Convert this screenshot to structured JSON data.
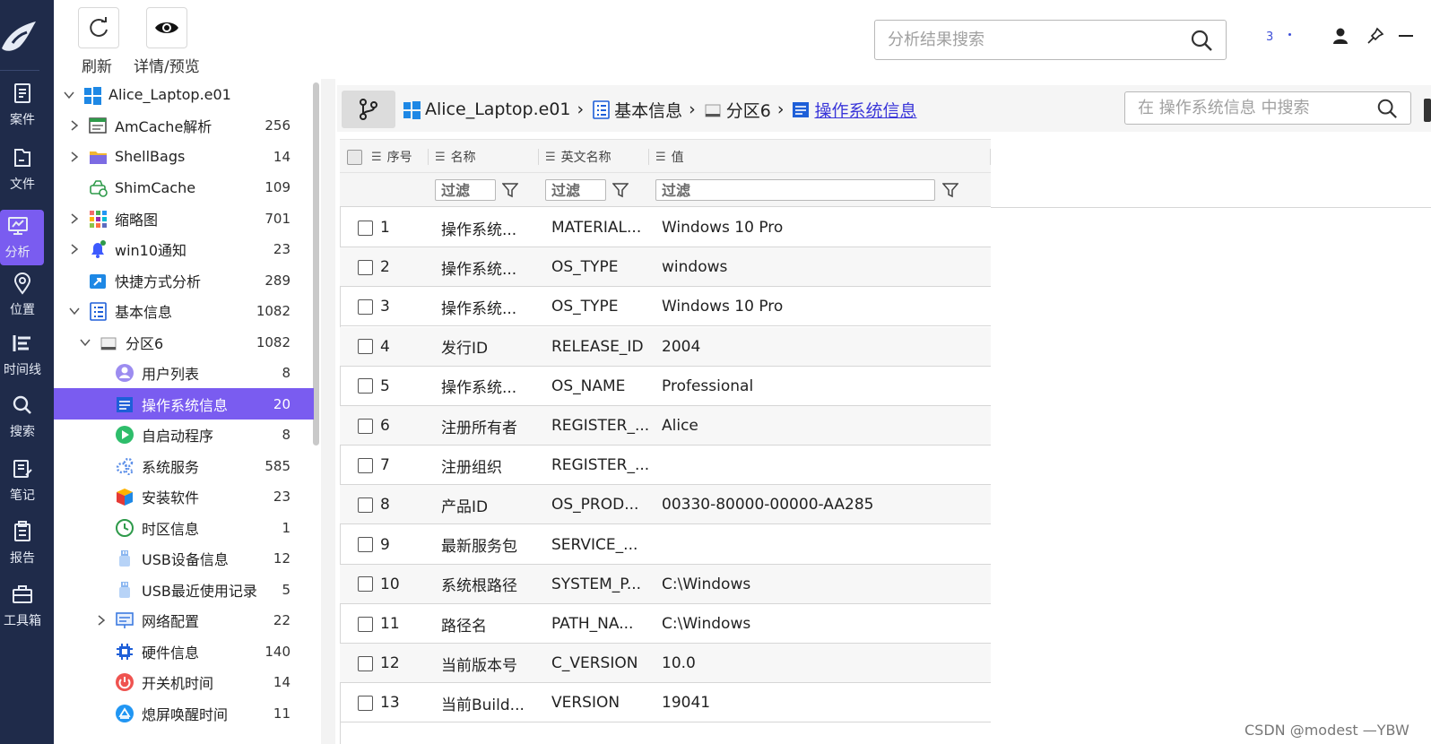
{
  "nav": [
    {
      "label": "案件",
      "icon": "case-icon"
    },
    {
      "label": "文件",
      "icon": "file-icon"
    },
    {
      "label": "分析",
      "icon": "analysis-icon",
      "active": true
    },
    {
      "label": "位置",
      "icon": "location-icon"
    },
    {
      "label": "时间线",
      "icon": "timeline-icon"
    },
    {
      "label": "搜索",
      "icon": "search-icon"
    },
    {
      "label": "笔记",
      "icon": "note-icon"
    },
    {
      "label": "报告",
      "icon": "report-icon"
    },
    {
      "label": "工具箱",
      "icon": "toolbox-icon"
    }
  ],
  "toolbar": {
    "refresh_label": "刷新",
    "preview_label": "详情/预览"
  },
  "top_search": {
    "placeholder": "分析结果搜索"
  },
  "top_count": "3",
  "tree": [
    {
      "label": "Alice_Laptop.e01",
      "count": "",
      "icon": "windows-icon",
      "depth": 0,
      "expand": "open"
    },
    {
      "label": "AmCache解析",
      "count": "256",
      "icon": "amcache-icon",
      "depth": 1,
      "expand": "closed"
    },
    {
      "label": "ShellBags",
      "count": "14",
      "icon": "folder-icon",
      "depth": 1,
      "expand": "closed"
    },
    {
      "label": "ShimCache",
      "count": "109",
      "icon": "shimcache-icon",
      "depth": 1,
      "expand": "none"
    },
    {
      "label": "缩略图",
      "count": "701",
      "icon": "thumbnail-icon",
      "depth": 1,
      "expand": "closed"
    },
    {
      "label": "win10通知",
      "count": "23",
      "icon": "bell-icon",
      "depth": 1,
      "expand": "closed"
    },
    {
      "label": "快捷方式分析",
      "count": "289",
      "icon": "shortcut-icon",
      "depth": 1,
      "expand": "none"
    },
    {
      "label": "基本信息",
      "count": "1082",
      "icon": "list-icon",
      "depth": 1,
      "expand": "open"
    },
    {
      "label": "分区6",
      "count": "1082",
      "icon": "disk-icon",
      "depth": 2,
      "expand": "open"
    },
    {
      "label": "用户列表",
      "count": "8",
      "icon": "user-icon",
      "depth": 3,
      "expand": "none"
    },
    {
      "label": "操作系统信息",
      "count": "20",
      "icon": "os-info-icon",
      "depth": 3,
      "expand": "none",
      "selected": true
    },
    {
      "label": "自启动程序",
      "count": "8",
      "icon": "play-icon",
      "depth": 3,
      "expand": "none"
    },
    {
      "label": "系统服务",
      "count": "585",
      "icon": "gears-icon",
      "depth": 3,
      "expand": "none"
    },
    {
      "label": "安装软件",
      "count": "23",
      "icon": "cube-icon",
      "depth": 3,
      "expand": "none"
    },
    {
      "label": "时区信息",
      "count": "1",
      "icon": "clock-icon",
      "depth": 3,
      "expand": "none"
    },
    {
      "label": "USB设备信息",
      "count": "12",
      "icon": "usb-icon",
      "depth": 3,
      "expand": "none"
    },
    {
      "label": "USB最近使用记录",
      "count": "5",
      "icon": "usb-icon",
      "depth": 3,
      "expand": "none"
    },
    {
      "label": "网络配置",
      "count": "22",
      "icon": "network-icon",
      "depth": 3,
      "expand": "closed"
    },
    {
      "label": "硬件信息",
      "count": "140",
      "icon": "chip-icon",
      "depth": 3,
      "expand": "none"
    },
    {
      "label": "开关机时间",
      "count": "14",
      "icon": "power-icon",
      "depth": 3,
      "expand": "none"
    },
    {
      "label": "熄屏唤醒时间",
      "count": "11",
      "icon": "screen-icon",
      "depth": 3,
      "expand": "none"
    }
  ],
  "breadcrumb": {
    "items": [
      {
        "label": "Alice_Laptop.e01",
        "icon": "windows-icon"
      },
      {
        "label": "基本信息",
        "icon": "list-icon"
      },
      {
        "label": "分区6",
        "icon": "disk-icon"
      },
      {
        "label": "操作系统信息",
        "icon": "os-info-icon",
        "link": true
      }
    ],
    "separator": "›"
  },
  "inner_search": {
    "placeholder": "在 操作系统信息 中搜索"
  },
  "table": {
    "headers": {
      "seq": "序号",
      "name": "名称",
      "en_name": "英文名称",
      "value": "值"
    },
    "filter_placeholder": "过滤",
    "rows": [
      {
        "seq": "1",
        "name": "操作系统...",
        "en": "MATERIAL...",
        "value": "Windows 10 Pro"
      },
      {
        "seq": "2",
        "name": "操作系统...",
        "en": "OS_TYPE",
        "value": "windows"
      },
      {
        "seq": "3",
        "name": "操作系统...",
        "en": "OS_TYPE",
        "value": "Windows 10 Pro"
      },
      {
        "seq": "4",
        "name": "发行ID",
        "en": "RELEASE_ID",
        "value": "2004"
      },
      {
        "seq": "5",
        "name": "操作系统...",
        "en": "OS_NAME",
        "value": "Professional"
      },
      {
        "seq": "6",
        "name": "注册所有者",
        "en": "REGISTER_...",
        "value": "Alice"
      },
      {
        "seq": "7",
        "name": "注册组织",
        "en": "REGISTER_...",
        "value": ""
      },
      {
        "seq": "8",
        "name": "产品ID",
        "en": "OS_PROD...",
        "value": "00330-80000-00000-AA285"
      },
      {
        "seq": "9",
        "name": "最新服务包",
        "en": "SERVICE_...",
        "value": ""
      },
      {
        "seq": "10",
        "name": "系统根路径",
        "en": "SYSTEM_P...",
        "value": "C:\\Windows"
      },
      {
        "seq": "11",
        "name": "路径名",
        "en": "PATH_NA...",
        "value": "C:\\Windows"
      },
      {
        "seq": "12",
        "name": "当前版本号",
        "en": "C_VERSION",
        "value": "10.0"
      },
      {
        "seq": "13",
        "name": "当前Build...",
        "en": "VERSION",
        "value": "19041"
      }
    ]
  },
  "watermark": "CSDN @modest —YBW",
  "colors": {
    "rail": "#1f2b4a",
    "accent": "#7a5cf0",
    "link": "#3a36d9"
  }
}
